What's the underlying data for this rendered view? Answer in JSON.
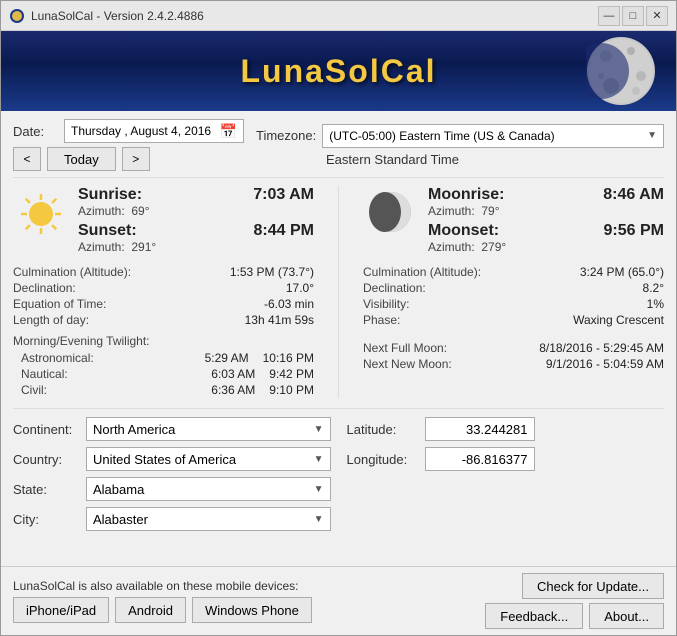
{
  "window": {
    "title": "LunaSolCal - Version 2.4.2.4886",
    "app_title": "LunaSolCal"
  },
  "title_bar": {
    "minimize": "—",
    "restore": "□",
    "close": "✕"
  },
  "date_section": {
    "label": "Date:",
    "date_value": "Thursday ,  August   4, 2016",
    "nav_prev": "<",
    "nav_next": ">",
    "today_btn": "Today"
  },
  "timezone_section": {
    "label": "Timezone:",
    "timezone_value": "(UTC-05:00) Eastern Time (US & Canada)",
    "timezone_sub": "Eastern Standard Time"
  },
  "sun": {
    "sunrise_label": "Sunrise:",
    "sunrise_time": "7:03 AM",
    "sunrise_az_label": "Azimuth:",
    "sunrise_az_value": "69°",
    "sunset_label": "Sunset:",
    "sunset_time": "8:44 PM",
    "sunset_az_label": "Azimuth:",
    "sunset_az_value": "291°",
    "culmination_label": "Culmination (Altitude):",
    "culmination_value": "1:53 PM (73.7°)",
    "declination_label": "Declination:",
    "declination_value": "17.0°",
    "equation_label": "Equation of Time:",
    "equation_value": "-6.03 min",
    "length_label": "Length of day:",
    "length_value": "13h 41m 59s",
    "twilight_header": "Morning/Evening Twilight:",
    "astronomical_label": "Astronomical:",
    "astronomical_morning": "5:29 AM",
    "astronomical_evening": "10:16 PM",
    "nautical_label": "Nautical:",
    "nautical_morning": "6:03 AM",
    "nautical_evening": "9:42 PM",
    "civil_label": "Civil:",
    "civil_morning": "6:36 AM",
    "civil_evening": "9:10 PM"
  },
  "moon": {
    "moonrise_label": "Moonrise:",
    "moonrise_time": "8:46 AM",
    "moonrise_az_label": "Azimuth:",
    "moonrise_az_value": "79°",
    "moonset_label": "Moonset:",
    "moonset_time": "9:56 PM",
    "moonset_az_label": "Azimuth:",
    "moonset_az_value": "279°",
    "culmination_label": "Culmination (Altitude):",
    "culmination_value": "3:24 PM (65.0°)",
    "declination_label": "Declination:",
    "declination_value": "8.2°",
    "visibility_label": "Visibility:",
    "visibility_value": "1%",
    "phase_label": "Phase:",
    "phase_value": "Waxing Crescent",
    "full_moon_label": "Next Full Moon:",
    "full_moon_value": "8/18/2016 - 5:29:45 AM",
    "new_moon_label": "Next New Moon:",
    "new_moon_value": "9/1/2016 - 5:04:59 AM"
  },
  "location": {
    "continent_label": "Continent:",
    "continent_value": "North America",
    "country_label": "Country:",
    "country_value": "United States of America",
    "state_label": "State:",
    "state_value": "Alabama",
    "city_label": "City:",
    "city_value": "Alabaster",
    "latitude_label": "Latitude:",
    "latitude_value": "33.244281",
    "longitude_label": "Longitude:",
    "longitude_value": "-86.816377"
  },
  "footer": {
    "mobile_label": "LunaSolCal is also available on these mobile devices:",
    "iphone_btn": "iPhone/iPad",
    "android_btn": "Android",
    "windows_phone_btn": "Windows Phone",
    "check_update_btn": "Check for Update...",
    "feedback_btn": "Feedback...",
    "about_btn": "About..."
  }
}
